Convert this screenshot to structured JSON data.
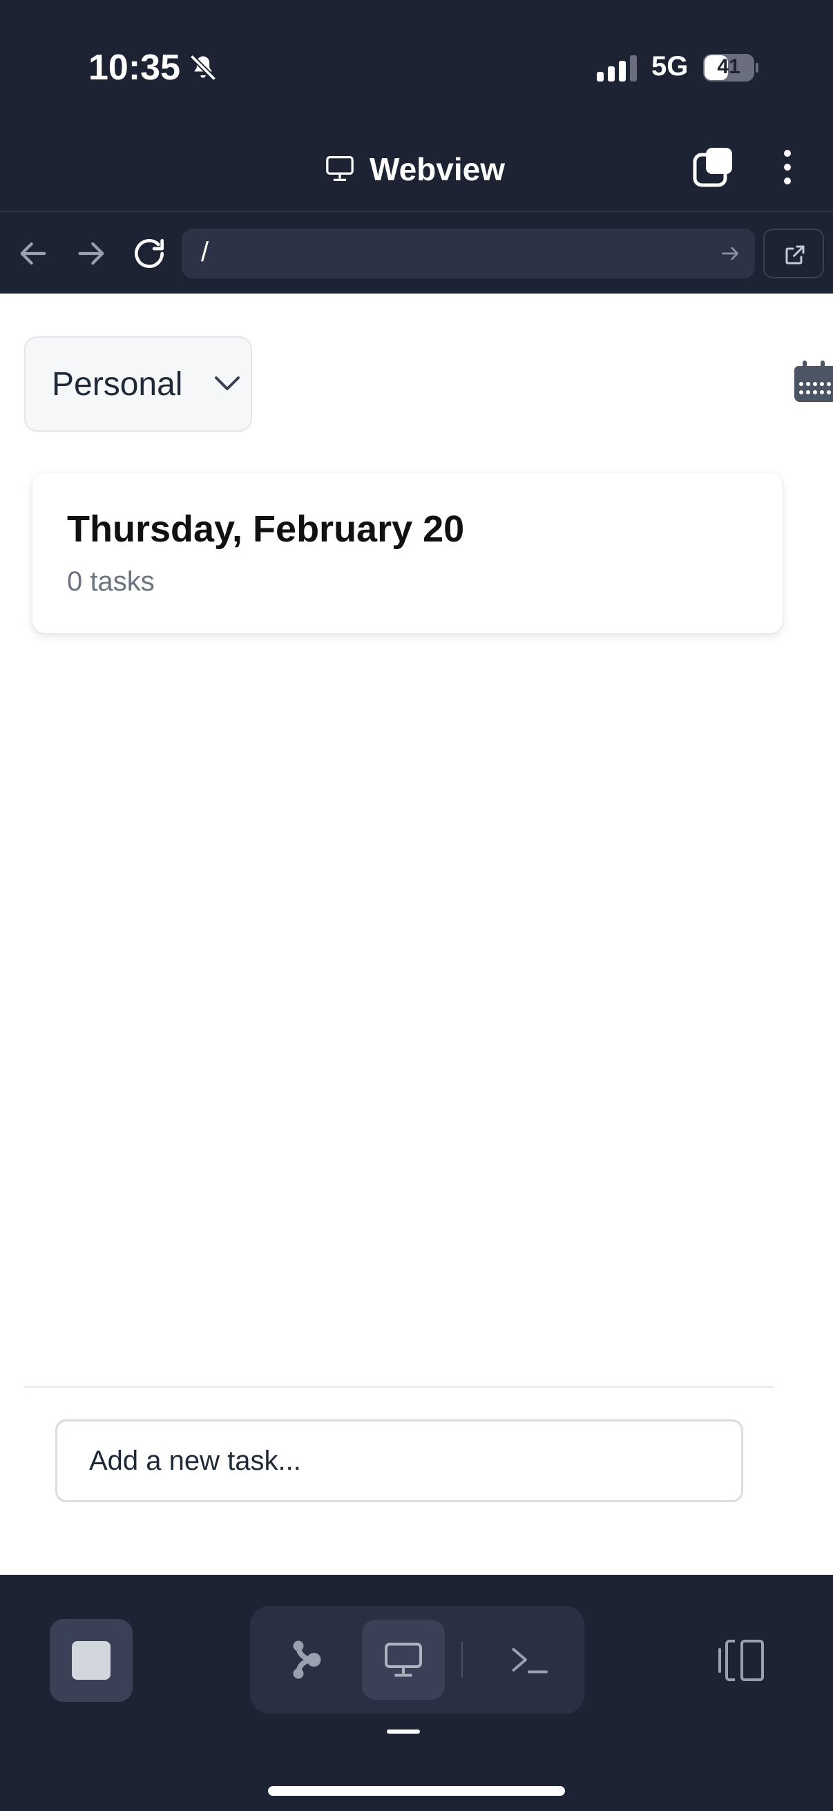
{
  "status_bar": {
    "time": "10:35",
    "network": "5G",
    "battery": "41",
    "icons": [
      "bell-slash-icon",
      "signal-icon",
      "battery-icon"
    ]
  },
  "header": {
    "title": "Webview",
    "icons": [
      "monitor-icon",
      "tabs-icon",
      "more-vertical-icon"
    ]
  },
  "navigation": {
    "url": "/",
    "icons": [
      "back-arrow-icon",
      "forward-arrow-icon",
      "reload-icon",
      "go-arrow-icon",
      "external-link-icon"
    ]
  },
  "app": {
    "list_selector": {
      "label": "Personal"
    },
    "day_card": {
      "title": "Thursday, February 20",
      "task_count": "0 tasks"
    },
    "new_task": {
      "placeholder": "Add a new task..."
    }
  },
  "bottom_bar": {
    "modes": [
      "branch-icon",
      "monitor-icon",
      "terminal-icon"
    ],
    "active_mode": "monitor-icon"
  },
  "colors": {
    "chrome_bg": "#1e2334",
    "card_bg": "#ffffff",
    "muted_text": "#6b7280"
  }
}
